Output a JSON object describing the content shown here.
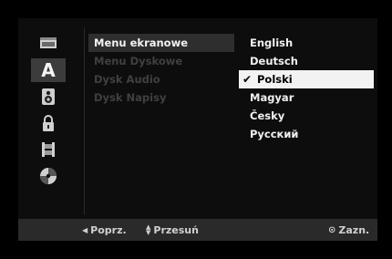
{
  "sidebar": {
    "icons": [
      {
        "name": "disc-tray-icon"
      },
      {
        "name": "language-icon",
        "glyph": "A"
      },
      {
        "name": "audio-speaker-icon"
      },
      {
        "name": "lock-icon"
      },
      {
        "name": "film-icon"
      },
      {
        "name": "disc-icon"
      }
    ],
    "selected_index": 1
  },
  "menu": {
    "items": [
      {
        "label": "Menu ekranowe",
        "selected": true
      },
      {
        "label": "Menu Dyskowe",
        "selected": false
      },
      {
        "label": "Dysk Audio",
        "selected": false
      },
      {
        "label": "Dysk Napisy",
        "selected": false
      }
    ]
  },
  "languages": {
    "items": [
      {
        "label": "English",
        "selected": false
      },
      {
        "label": "Deutsch",
        "selected": false
      },
      {
        "label": "Polski",
        "selected": true
      },
      {
        "label": "Magyar",
        "selected": false
      },
      {
        "label": "Česky",
        "selected": false
      },
      {
        "label": "Русский",
        "selected": false
      }
    ],
    "check_glyph": "✔"
  },
  "footer": {
    "prev_label": "Poprz.",
    "move_label": "Przesuń",
    "select_label": "Zazn."
  },
  "colors": {
    "highlight_dark": "#2e2e2e",
    "highlight_light": "#f2f2f2",
    "footer_bg": "#2a2a2a"
  }
}
